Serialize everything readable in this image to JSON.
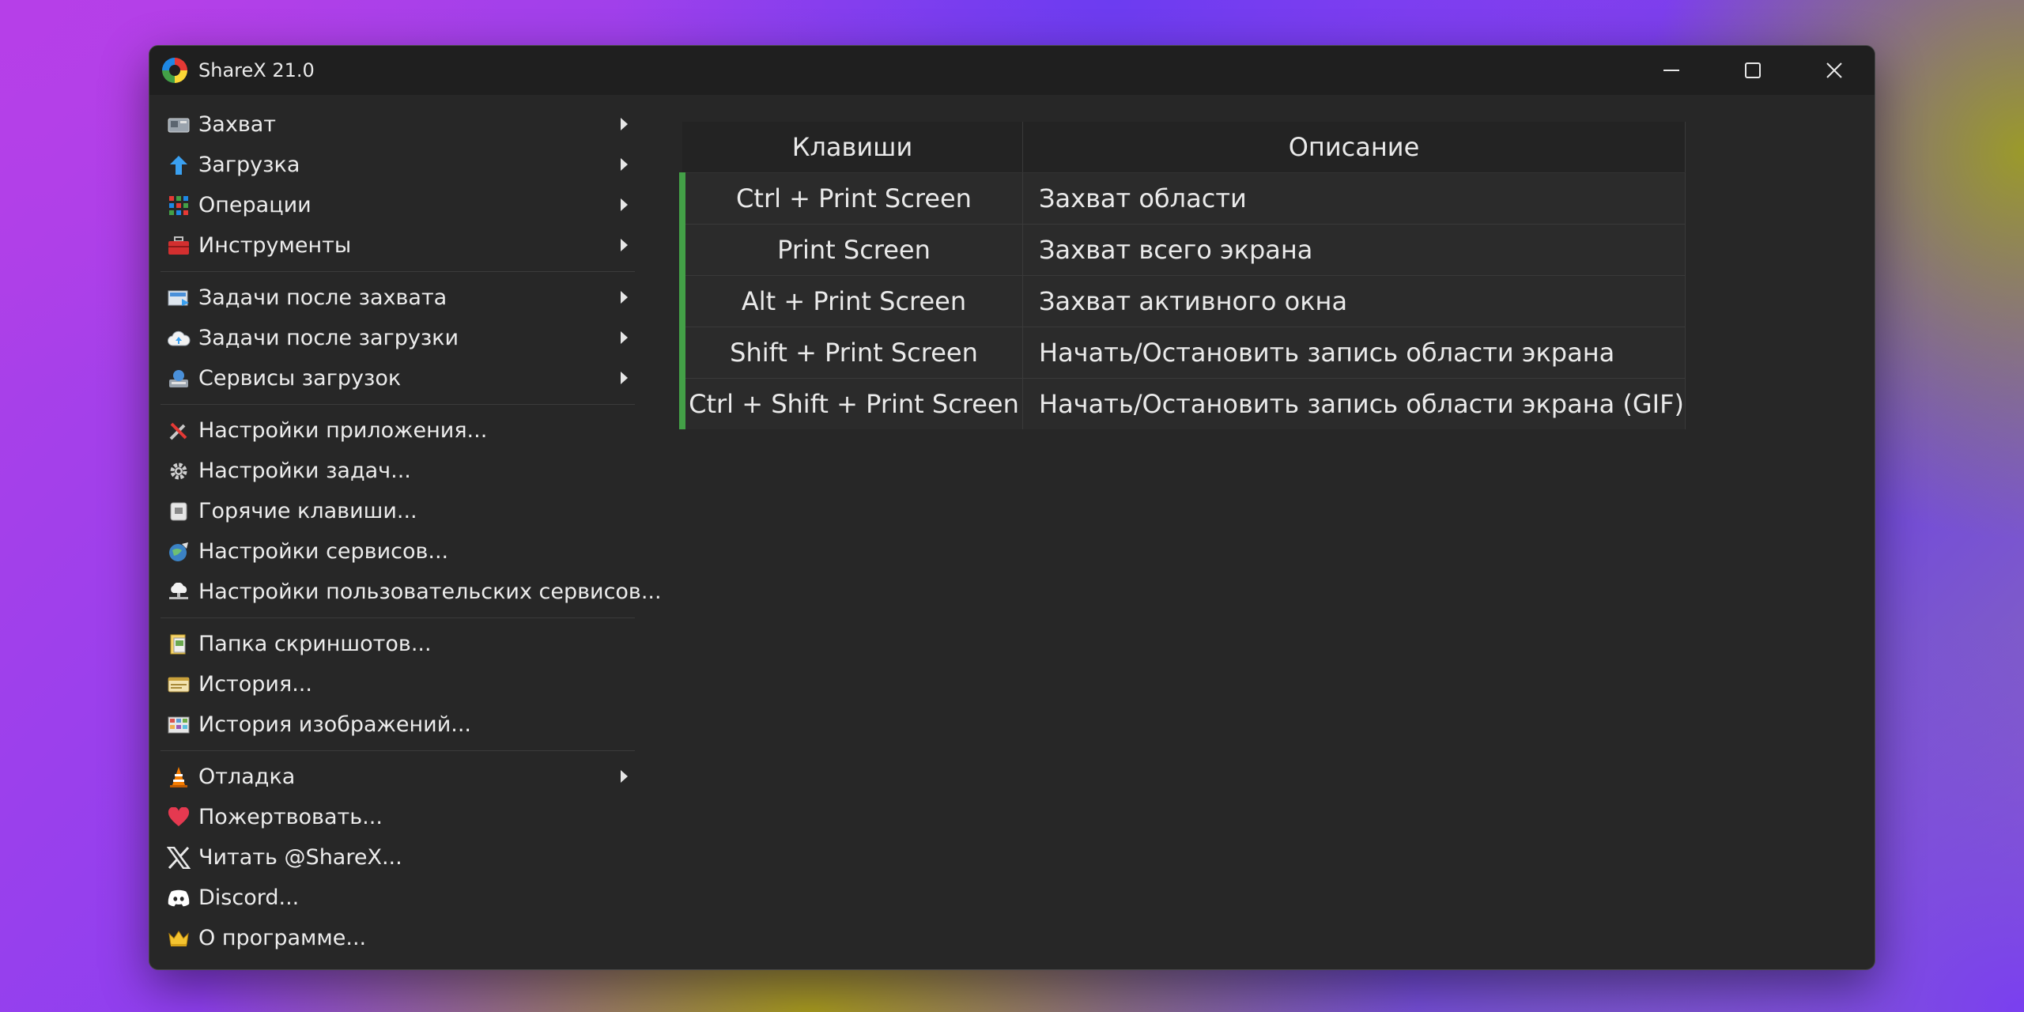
{
  "window": {
    "title": "ShareX 21.0"
  },
  "menu": {
    "groups": [
      [
        {
          "label": "Захват",
          "icon": "camera-icon",
          "submenu": true
        },
        {
          "label": "Загрузка",
          "icon": "upload-arrow-icon",
          "submenu": true
        },
        {
          "label": "Операции",
          "icon": "dots-grid-icon",
          "submenu": true
        },
        {
          "label": "Инструменты",
          "icon": "toolbox-icon",
          "submenu": true
        }
      ],
      [
        {
          "label": "Задачи после захвата",
          "icon": "after-capture-icon",
          "submenu": true
        },
        {
          "label": "Задачи после загрузки",
          "icon": "cloud-icon",
          "submenu": true
        },
        {
          "label": "Сервисы загрузок",
          "icon": "upload-services-icon",
          "submenu": true
        }
      ],
      [
        {
          "label": "Настройки приложения...",
          "icon": "tools-icon",
          "submenu": false
        },
        {
          "label": "Настройки задач...",
          "icon": "gear-icon",
          "submenu": false
        },
        {
          "label": "Горячие клавиши...",
          "icon": "keyboard-icon",
          "submenu": false
        },
        {
          "label": "Настройки сервисов...",
          "icon": "globe-icon",
          "submenu": false
        },
        {
          "label": "Настройки пользовательских сервисов...",
          "icon": "server-cloud-icon",
          "submenu": false
        }
      ],
      [
        {
          "label": "Папка скриншотов...",
          "icon": "folder-icon",
          "submenu": false
        },
        {
          "label": "История...",
          "icon": "history-icon",
          "submenu": false
        },
        {
          "label": "История изображений...",
          "icon": "image-history-icon",
          "submenu": false
        }
      ],
      [
        {
          "label": "Отладка",
          "icon": "traffic-cone-icon",
          "submenu": true
        },
        {
          "label": "Пожертвовать...",
          "icon": "heart-icon",
          "submenu": false
        },
        {
          "label": "Читать @ShareX...",
          "icon": "x-logo-icon",
          "submenu": false
        },
        {
          "label": "Discord...",
          "icon": "discord-icon",
          "submenu": false
        },
        {
          "label": "О программе...",
          "icon": "crown-icon",
          "submenu": false
        }
      ]
    ]
  },
  "hotkeys": {
    "columns": [
      "Клавиши",
      "Описание"
    ],
    "rows": [
      {
        "keys": "Ctrl + Print Screen",
        "description": "Захват области"
      },
      {
        "keys": "Print Screen",
        "description": "Захват всего экрана"
      },
      {
        "keys": "Alt + Print Screen",
        "description": "Захват активного окна"
      },
      {
        "keys": "Shift + Print Screen",
        "description": "Начать/Остановить запись области экрана"
      },
      {
        "keys": "Ctrl + Shift + Print Screen",
        "description": "Начать/Остановить запись области экрана (GIF)"
      }
    ],
    "accent_color": "#43a047"
  }
}
